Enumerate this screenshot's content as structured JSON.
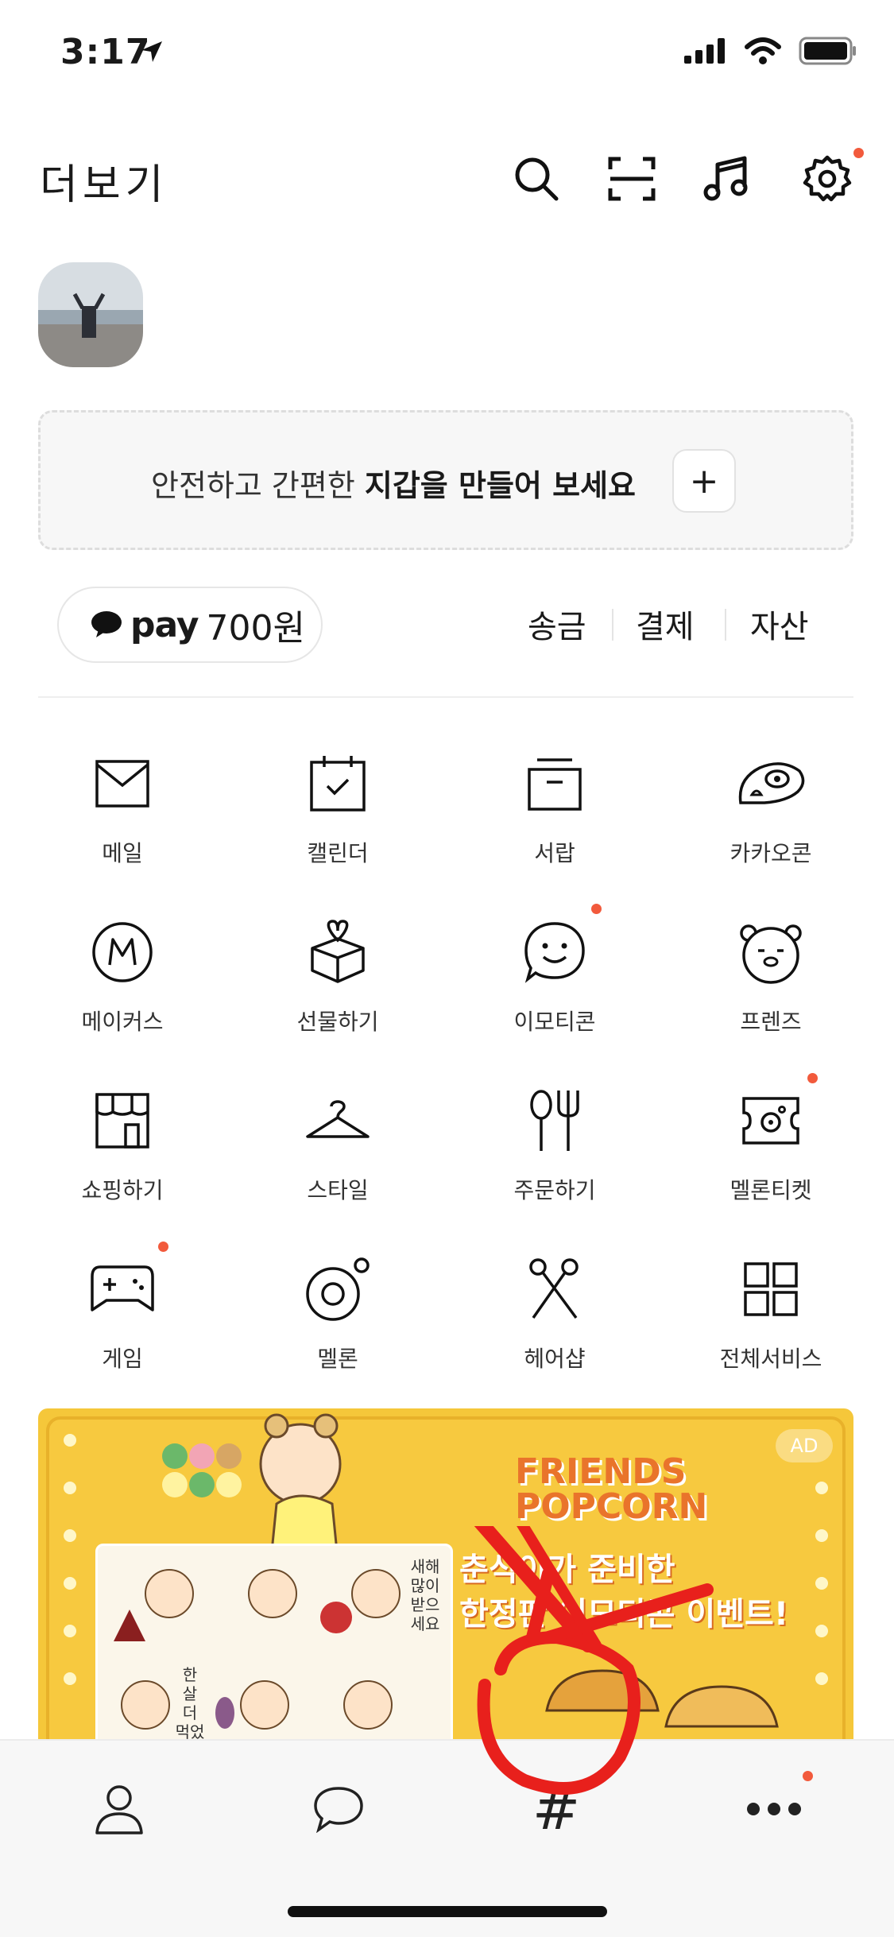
{
  "status": {
    "time": "3:17"
  },
  "header": {
    "title": "더보기"
  },
  "wallet": {
    "prompt_plain": "안전하고 간편한 ",
    "prompt_bold": "지갑을 만들어 보세요",
    "add_label": "+"
  },
  "pay": {
    "logo": "pay",
    "amount": "700원",
    "links": [
      "송금",
      "결제",
      "자산"
    ]
  },
  "services": [
    {
      "label": "메일",
      "icon": "mail-icon"
    },
    {
      "label": "캘린더",
      "icon": "calendar-icon"
    },
    {
      "label": "서랍",
      "icon": "drawer-icon"
    },
    {
      "label": "카카오콘",
      "icon": "kakaocon-icon"
    },
    {
      "label": "메이커스",
      "icon": "makers-icon"
    },
    {
      "label": "선물하기",
      "icon": "gift-icon"
    },
    {
      "label": "이모티콘",
      "icon": "emoticon-icon"
    },
    {
      "label": "프렌즈",
      "icon": "friends-icon"
    },
    {
      "label": "쇼핑하기",
      "icon": "shopping-icon"
    },
    {
      "label": "스타일",
      "icon": "hanger-icon"
    },
    {
      "label": "주문하기",
      "icon": "order-icon"
    },
    {
      "label": "멜론티켓",
      "icon": "melon-ticket-icon"
    },
    {
      "label": "게임",
      "icon": "game-icon"
    },
    {
      "label": "멜론",
      "icon": "melon-icon"
    },
    {
      "label": "헤어샵",
      "icon": "scissors-icon"
    },
    {
      "label": "전체서비스",
      "icon": "all-services-icon"
    }
  ],
  "banner": {
    "ad": "AD",
    "brand_line1": "FRIENDS",
    "brand_line2": "POPCORN",
    "line2": "춘식이가 준비한",
    "line3": "한정판 이모티콘 이벤트!",
    "sticker_text1": "새해 많이 받으세요",
    "sticker_text2": "한 살 더 먹었다"
  },
  "tabs": [
    {
      "name": "friends-tab",
      "icon": "person-icon"
    },
    {
      "name": "chats-tab",
      "icon": "chat-bubble-icon"
    },
    {
      "name": "view-tab",
      "icon": "hash-icon",
      "glyph": "#"
    },
    {
      "name": "more-tab",
      "icon": "more-dots-icon"
    }
  ],
  "colors": {
    "notification_dot": "#f25a3c",
    "banner_bg": "#f5c73a",
    "annotation": "#e8201c"
  }
}
